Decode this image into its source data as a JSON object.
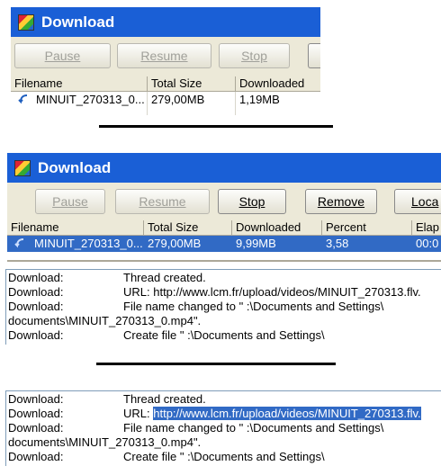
{
  "panel1": {
    "title": "Download",
    "buttons": {
      "pause": "Pause",
      "resume": "Resume",
      "stop": "Stop"
    },
    "columns": [
      "Filename",
      "Total Size",
      "Downloaded"
    ],
    "row": {
      "filename": "MINUIT_270313_0...",
      "total": "279,00MB",
      "downloaded": "1,19MB"
    }
  },
  "panel2": {
    "title": "Download",
    "buttons": {
      "pause": "Pause",
      "resume": "Resume",
      "stop": "Stop",
      "remove": "Remove",
      "locate": "Loca"
    },
    "columns": [
      "Filename",
      "Total Size",
      "Downloaded",
      "Percent",
      "Elap"
    ],
    "row": {
      "filename": "MINUIT_270313_0...",
      "total": "279,00MB",
      "downloaded": "9,99MB",
      "percent": "3,58",
      "elapsed": "00:0"
    }
  },
  "log1": [
    {
      "source": "Download:",
      "message": "Thread created."
    },
    {
      "source": "Download:",
      "message": "URL: http://www.lcm.fr/upload/videos/MINUIT_270313.flv."
    },
    {
      "source": "Download:",
      "message": "File name changed to \"    :\\Documents and Settings\\"
    },
    {
      "source": "",
      "message": "documents\\MINUIT_270313_0.mp4\"."
    },
    {
      "source": "Download:",
      "message": "Create file \"    :\\Documents and Settings\\"
    }
  ],
  "log2": [
    {
      "source": "Download:",
      "message": "Thread created."
    },
    {
      "source": "Download:",
      "prefix": "URL: ",
      "highlight": "http://www.lcm.fr/upload/videos/MINUIT_270313.flv."
    },
    {
      "source": "Download:",
      "message": "File name changed to \"    :\\Documents and Settings\\"
    },
    {
      "source": "",
      "message": "documents\\MINUIT_270313_0.mp4\"."
    },
    {
      "source": "Download:",
      "message": "Create file \"    :\\Documents and Settings\\"
    }
  ],
  "colors": {
    "titlebar": "#1a5fd6",
    "selection": "#316ac5",
    "toolbar": "#ece9d8"
  }
}
